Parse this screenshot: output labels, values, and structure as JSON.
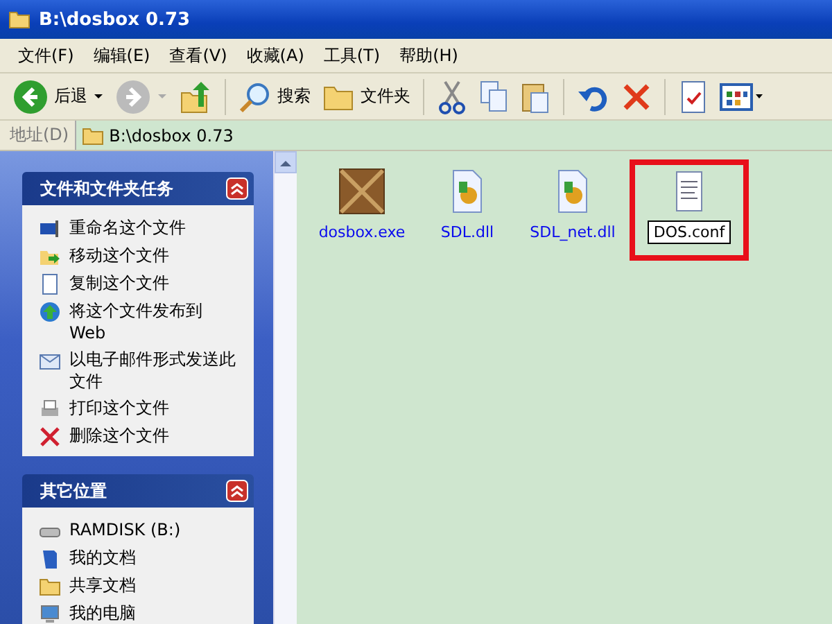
{
  "window": {
    "title": "B:\\dosbox 0.73"
  },
  "menu": [
    "文件(F)",
    "编辑(E)",
    "查看(V)",
    "收藏(A)",
    "工具(T)",
    "帮助(H)"
  ],
  "toolbar": [
    {
      "kind": "back",
      "label": "后退"
    },
    {
      "kind": "forward"
    },
    {
      "kind": "up"
    },
    {
      "kind": "search",
      "label": "搜索"
    },
    {
      "kind": "folders",
      "label": "文件夹"
    },
    {
      "kind": "cut"
    },
    {
      "kind": "copy"
    },
    {
      "kind": "paste"
    },
    {
      "kind": "undo"
    },
    {
      "kind": "delete"
    },
    {
      "kind": "properties"
    },
    {
      "kind": "views"
    }
  ],
  "address": {
    "label": "地址(D)",
    "value": "B:\\dosbox 0.73"
  },
  "sidebar": {
    "panels": [
      {
        "title": "文件和文件夹任务",
        "expanded": true,
        "items": [
          {
            "kind": "rename",
            "label": "重命名这个文件"
          },
          {
            "kind": "move",
            "label": "移动这个文件"
          },
          {
            "kind": "copy",
            "label": "复制这个文件"
          },
          {
            "kind": "web",
            "label": "将这个文件发布到 Web"
          },
          {
            "kind": "email",
            "label": "以电子邮件形式发送此文件"
          },
          {
            "kind": "print",
            "label": "打印这个文件"
          },
          {
            "kind": "delete",
            "label": "删除这个文件"
          }
        ]
      },
      {
        "title": "其它位置",
        "expanded": true,
        "items": [
          {
            "kind": "drive",
            "label": "RAMDISK (B:)"
          },
          {
            "kind": "docs",
            "label": "我的文档"
          },
          {
            "kind": "folder",
            "label": "共享文档"
          },
          {
            "kind": "computer",
            "label": "我的电脑"
          }
        ]
      }
    ]
  },
  "files": [
    {
      "kind": "exe",
      "name": "dosbox.exe",
      "selected": false,
      "highlighted": false
    },
    {
      "kind": "dll",
      "name": "SDL.dll",
      "selected": false,
      "highlighted": false
    },
    {
      "kind": "dll",
      "name": "SDL_net.dll",
      "selected": false,
      "highlighted": false
    },
    {
      "kind": "text",
      "name": "DOS.conf",
      "selected": true,
      "highlighted": true
    }
  ]
}
